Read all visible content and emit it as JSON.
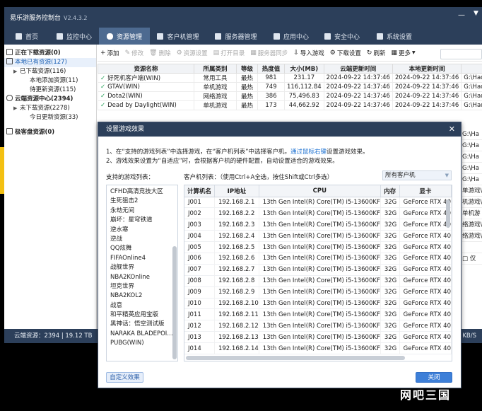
{
  "titlebar": {
    "title": "易乐游服务控制台",
    "version": "V2.4.3.2"
  },
  "nav": [
    {
      "label": "首页",
      "icon": "home-icon"
    },
    {
      "label": "监控中心",
      "icon": "monitor-icon"
    },
    {
      "label": "资源管理",
      "icon": "gamepad-icon",
      "active": true
    },
    {
      "label": "客户机管理",
      "icon": "client-icon"
    },
    {
      "label": "服务器管理",
      "icon": "server-icon"
    },
    {
      "label": "应用中心",
      "icon": "app-icon"
    },
    {
      "label": "安全中心",
      "icon": "shield-icon"
    },
    {
      "label": "系统设置",
      "icon": "gear-icon"
    }
  ],
  "sidebar": [
    {
      "label": "正在下载资源(0)",
      "bold": true,
      "icon": "download-icon",
      "indent": 0
    },
    {
      "label": "本地已有资源(127)",
      "bold": false,
      "icon": "folder-icon",
      "indent": 0,
      "selected": true,
      "arrow": "▲"
    },
    {
      "label": "已下载资源(116)",
      "indent": 1,
      "arrow": "▶"
    },
    {
      "label": "本地添加资源(11)",
      "indent": 2
    },
    {
      "label": "待更新资源(115)",
      "indent": 2
    },
    {
      "label": "云端资源中心(2394)",
      "bold": true,
      "icon": "cloud-icon",
      "indent": 0,
      "arrow": "▲"
    },
    {
      "label": "未下载资源(2278)",
      "indent": 1,
      "arrow": "▶"
    },
    {
      "label": "今日更新资源(33)",
      "indent": 2
    },
    {
      "label": "极客盘资源(0)",
      "bold": true,
      "icon": "disk-icon",
      "indent": 0
    }
  ],
  "toolbar": [
    {
      "label": "添加",
      "glyph": "+",
      "disabled": false
    },
    {
      "label": "修改",
      "glyph": "✎",
      "disabled": true
    },
    {
      "label": "删除",
      "glyph": "🗑",
      "disabled": true
    },
    {
      "label": "资源设置",
      "glyph": "⚙",
      "disabled": true
    },
    {
      "label": "打开目录",
      "glyph": "▤",
      "disabled": true
    },
    {
      "label": "服务器同步",
      "glyph": "▦",
      "disabled": true
    },
    {
      "label": "导入游戏",
      "glyph": "⇩",
      "disabled": false
    },
    {
      "label": "下载设置",
      "glyph": "⚙",
      "disabled": false
    },
    {
      "label": "刷新",
      "glyph": "↻",
      "disabled": false
    },
    {
      "label": "更多",
      "glyph": "▦",
      "disabled": false,
      "dropdown": "▼"
    }
  ],
  "grid": {
    "columns": [
      "资源名称",
      "所属类别",
      "等级",
      "热度值",
      "大小(MB)",
      "云端更新时间",
      "本地更新时间",
      ""
    ],
    "rows": [
      [
        "好死机客户端(WIN)",
        "常用工具",
        "最热",
        "981",
        "231.17",
        "2024-09-22 14:37:46",
        "2024-09-22 14:37:46",
        "G:\\Haosiji\\Re"
      ],
      [
        "GTAV(WIN)",
        "单机游戏",
        "最热",
        "749",
        "116,112.84",
        "2024-09-22 14:37:46",
        "2024-09-22 14:37:46",
        "G:\\Haosiji\\Re"
      ],
      [
        "Dota2(WIN)",
        "网络游戏",
        "最热",
        "386",
        "75,496.83",
        "2024-09-22 14:37:46",
        "2024-09-22 14:37:46",
        "G:\\Haosiji\\Re"
      ],
      [
        "Dead by Daylight(WIN)",
        "单机游戏",
        "最热",
        "173",
        "44,662.92",
        "2024-09-22 14:37:46",
        "2024-09-22 14:37:46",
        "G:\\Haosiji\\Re"
      ]
    ],
    "right_overflow": [
      "G:\\Ha",
      "G:\\Ha",
      "G:\\Ha",
      "G:\\Ha",
      "G:\\Ha",
      "单游戏\\",
      "机游戏\\",
      "单机游",
      "络游戏\\",
      "络游戏\\",
      "",
      "□ 仅"
    ]
  },
  "statusbar": {
    "left": "云端资源：2394 | 19.12 TB",
    "right": "KB/S"
  },
  "dialog": {
    "title": "设置游戏效果",
    "note1_a": "1、在“支持的游戏列表”中选择游戏，在“客户机列表”中选择客户机，",
    "note1_link": "通过鼠标右键",
    "note1_b": "设置游戏效果。",
    "note2": "2、游戏效果设置为“自适应”时，会根据客户机的硬件配置，自动设置适合的游戏效果。",
    "games_label": "支持的游戏列表：",
    "clients_label": "客户机列表：（使用Ctrl+A全选，按住Shift或Ctrl多选）",
    "combo": "所有客户机",
    "games": [
      "CFHD高清竞技大区",
      "生死狙击2",
      "永劫无间",
      "崩坏：星穹铁道",
      "逆水寒",
      "逆战",
      "QQ炫舞",
      "FIFAOnline4",
      "战舰世界",
      "NBA2KOnline",
      "坦克世界",
      "NBA2KOL2",
      "战意",
      "和平精英应用宝版",
      "黑神话：悟空测试版",
      "NARAKA BLADEPOI…",
      "PUBG(WIN)"
    ],
    "client_columns": [
      "计算机名",
      "IP地址",
      "CPU",
      "内存",
      "显卡"
    ],
    "clients": [
      [
        "J001",
        "192.168.2.1",
        "13th Gen Intel(R) Core(TM) i5-13600KF",
        "32G",
        "GeForce RTX 40"
      ],
      [
        "J002",
        "192.168.2.2",
        "13th Gen Intel(R) Core(TM) i5-13600KF",
        "32G",
        "GeForce RTX 40"
      ],
      [
        "J003",
        "192.168.2.3",
        "13th Gen Intel(R) Core(TM) i5-13600KF",
        "32G",
        "GeForce RTX 40"
      ],
      [
        "J004",
        "192.168.2.4",
        "13th Gen Intel(R) Core(TM) i5-13600KF",
        "32G",
        "GeForce RTX 40"
      ],
      [
        "J005",
        "192.168.2.5",
        "13th Gen Intel(R) Core(TM) i5-13600KF",
        "32G",
        "GeForce RTX 40"
      ],
      [
        "J006",
        "192.168.2.6",
        "13th Gen Intel(R) Core(TM) i5-13600KF",
        "32G",
        "GeForce RTX 40"
      ],
      [
        "J007",
        "192.168.2.7",
        "13th Gen Intel(R) Core(TM) i5-13600KF",
        "32G",
        "GeForce RTX 40"
      ],
      [
        "J008",
        "192.168.2.8",
        "13th Gen Intel(R) Core(TM) i5-13600KF",
        "32G",
        "GeForce RTX 40"
      ],
      [
        "J009",
        "192.168.2.9",
        "13th Gen Intel(R) Core(TM) i5-13600KF",
        "32G",
        "GeForce RTX 40"
      ],
      [
        "J010",
        "192.168.2.10",
        "13th Gen Intel(R) Core(TM) i5-13600KF",
        "32G",
        "GeForce RTX 40"
      ],
      [
        "J011",
        "192.168.2.11",
        "13th Gen Intel(R) Core(TM) i5-13600KF",
        "32G",
        "GeForce RTX 40"
      ],
      [
        "J012",
        "192.168.2.12",
        "13th Gen Intel(R) Core(TM) i5-13600KF",
        "32G",
        "GeForce RTX 40"
      ],
      [
        "J013",
        "192.168.2.13",
        "13th Gen Intel(R) Core(TM) i5-13600KF",
        "32G",
        "GeForce RTX 40"
      ],
      [
        "J014",
        "192.168.2.14",
        "13th Gen Intel(R) Core(TM) i5-13600KF",
        "32G",
        "GeForce RTX 40"
      ]
    ],
    "custom_button": "自定义效果",
    "close_button": "关闭"
  },
  "watermark": "网吧三国"
}
